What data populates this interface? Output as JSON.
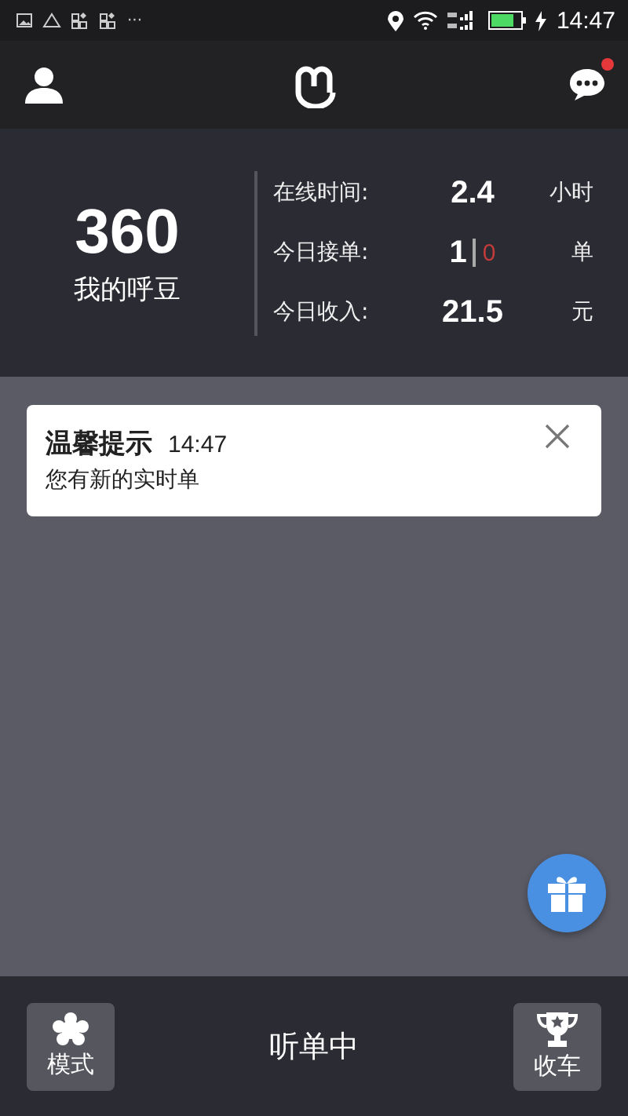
{
  "status_bar": {
    "time": "14:47",
    "more": "···"
  },
  "header": {
    "messages_unread": true
  },
  "summary": {
    "points": "360",
    "points_label": "我的呼豆"
  },
  "stats": [
    {
      "label": "在线时间:",
      "value": "2.4",
      "unit": "小时"
    },
    {
      "label": "今日接单:",
      "value": "1",
      "extra": "0",
      "unit": "单"
    },
    {
      "label": "今日收入:",
      "value": "21.5",
      "unit": "元"
    }
  ],
  "notice": {
    "title": "温馨提示",
    "time": "14:47",
    "message": "您有新的实时单"
  },
  "bottom_bar": {
    "mode_label": "模式",
    "status": "听单中",
    "stop_label": "收车"
  }
}
